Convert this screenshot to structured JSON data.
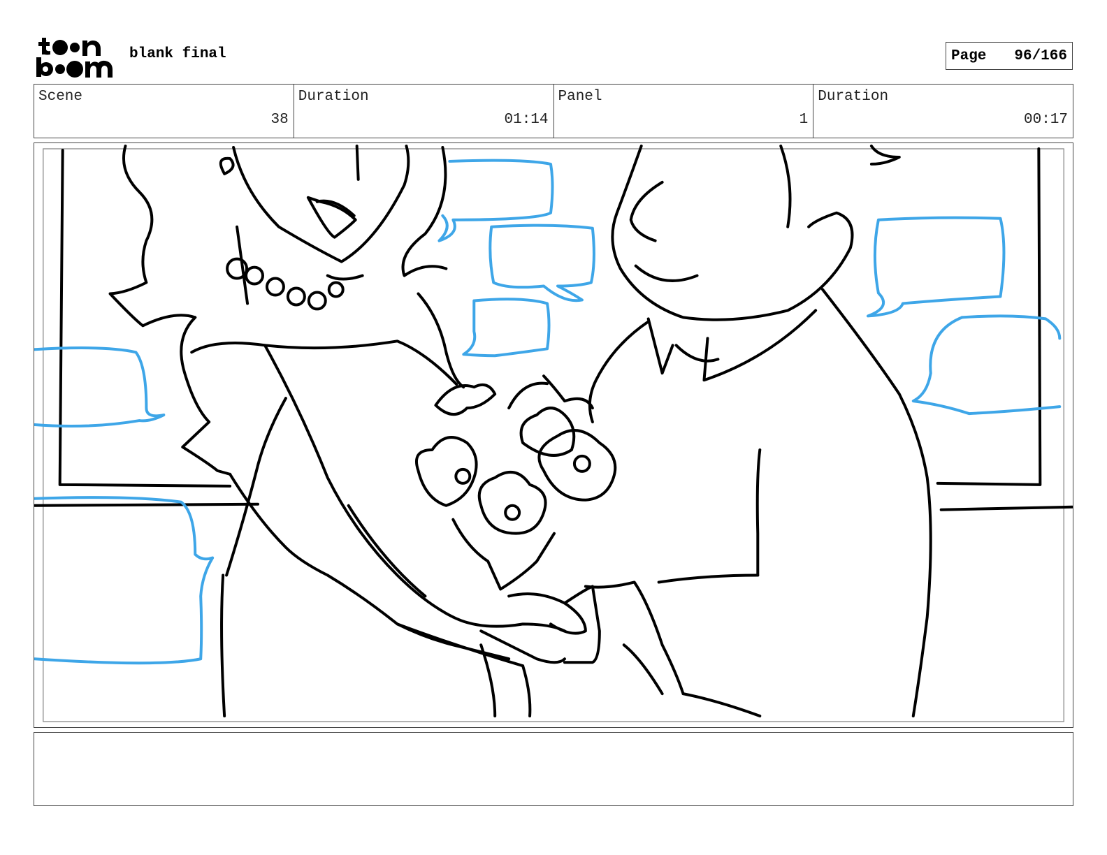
{
  "header": {
    "logo": {
      "line1": "toon",
      "line2": "boom",
      "icon": "toon-boom-logo"
    },
    "project_title": "blank final",
    "page_label": "Page",
    "page_number": "96/166"
  },
  "info": {
    "scene_label": "Scene",
    "scene_value": "38",
    "scene_duration_label": "Duration",
    "scene_duration_value": "01:14",
    "panel_label": "Panel",
    "panel_value": "1",
    "panel_duration_label": "Duration",
    "panel_duration_value": "00:17"
  },
  "panel": {
    "image": "storyboard-sketch-couple-holding-bouquet",
    "colors": {
      "line": "#000000",
      "speech_bubble": "#3ea6e8"
    }
  },
  "notes": {
    "text": ""
  }
}
